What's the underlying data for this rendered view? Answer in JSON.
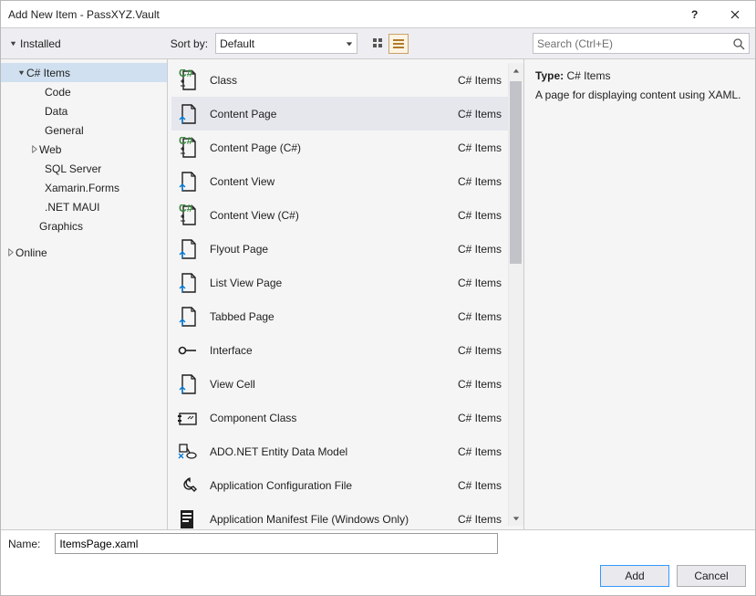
{
  "window": {
    "title": "Add New Item - PassXYZ.Vault"
  },
  "toolbar": {
    "installed_label": "Installed",
    "sortby_label": "Sort by:",
    "sort_value": "Default",
    "search_placeholder": "Search (Ctrl+E)"
  },
  "tree": {
    "csharp_items": "C# Items",
    "code": "Code",
    "data": "Data",
    "general": "General",
    "web": "Web",
    "sqlserver": "SQL Server",
    "xamarin": "Xamarin.Forms",
    "maui": ".NET MAUI",
    "graphics": "Graphics",
    "online": "Online"
  },
  "templates": [
    {
      "name": "Class",
      "cat": "C# Items"
    },
    {
      "name": "Content Page",
      "cat": "C# Items"
    },
    {
      "name": "Content Page (C#)",
      "cat": "C# Items"
    },
    {
      "name": "Content View",
      "cat": "C# Items"
    },
    {
      "name": "Content View (C#)",
      "cat": "C# Items"
    },
    {
      "name": "Flyout Page",
      "cat": "C# Items"
    },
    {
      "name": "List View Page",
      "cat": "C# Items"
    },
    {
      "name": "Tabbed Page",
      "cat": "C# Items"
    },
    {
      "name": "Interface",
      "cat": "C# Items"
    },
    {
      "name": "View Cell",
      "cat": "C# Items"
    },
    {
      "name": "Component Class",
      "cat": "C# Items"
    },
    {
      "name": "ADO.NET Entity Data Model",
      "cat": "C# Items"
    },
    {
      "name": "Application Configuration File",
      "cat": "C# Items"
    },
    {
      "name": "Application Manifest File (Windows Only)",
      "cat": "C# Items"
    }
  ],
  "details": {
    "type_label": "Type:",
    "type_value": "C# Items",
    "description": "A page for displaying content using XAML."
  },
  "name_field": {
    "label": "Name:",
    "value": "ItemsPage.xaml"
  },
  "buttons": {
    "add": "Add",
    "cancel": "Cancel"
  }
}
